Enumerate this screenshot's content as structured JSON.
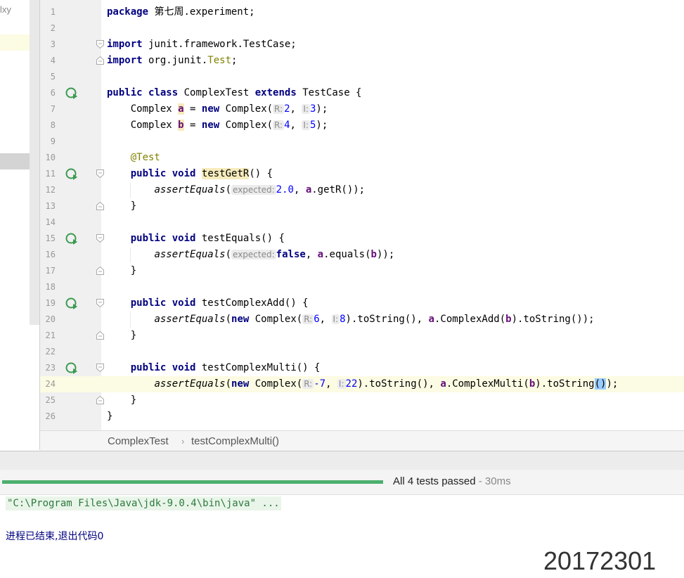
{
  "project_panel": {
    "label": "lxy"
  },
  "editor": {
    "lines": [
      {
        "num": "1"
      },
      {
        "num": "2"
      },
      {
        "num": "3"
      },
      {
        "num": "4"
      },
      {
        "num": "5"
      },
      {
        "num": "6"
      },
      {
        "num": "7"
      },
      {
        "num": "8"
      },
      {
        "num": "9"
      },
      {
        "num": "10"
      },
      {
        "num": "11"
      },
      {
        "num": "12"
      },
      {
        "num": "13"
      },
      {
        "num": "14"
      },
      {
        "num": "15"
      },
      {
        "num": "16"
      },
      {
        "num": "17"
      },
      {
        "num": "18"
      },
      {
        "num": "19"
      },
      {
        "num": "20"
      },
      {
        "num": "21"
      },
      {
        "num": "22"
      },
      {
        "num": "23"
      },
      {
        "num": "24"
      },
      {
        "num": "25"
      },
      {
        "num": "26"
      }
    ],
    "current_line": "24",
    "run_icon": "run-test-icon",
    "t": {
      "package_kw": "package",
      "package_name": " 第七周.experiment;",
      "import_kw": "import",
      "import1": " junit.framework.TestCase;",
      "import2_a": " org.junit.",
      "import2_test": "Test",
      "semi": ";",
      "public": "public",
      "class": "class",
      "class_name": " ComplexTest ",
      "extends": "extends",
      "parent": " TestCase {",
      "type_complex": "Complex ",
      "var_a": "a",
      "var_b": "b",
      "eq_new": " = ",
      "new": "new",
      "complex_ctor": " Complex(",
      "hint_r": "R:",
      "hint_i": "I:",
      "num_2": "2",
      "num_3": "3",
      "num_4": "4",
      "num_5": "5",
      "comma": ", ",
      "close_semi": ");",
      "at_test": "@Test",
      "void": "void",
      "testGetR": "testGetR",
      "sig_end": "() {",
      "assertEquals": "assertEquals",
      "open_paren": "(",
      "hint_expected": "expected:",
      "num_2_0": "2.0",
      "getR_call": ".getR());",
      "close_brace": "}",
      "testEquals": " testEquals() {",
      "false": "false",
      "equals_call": ".equals(",
      "close2": "));",
      "testComplexAdd": " testComplexAdd() {",
      "num_6": "6",
      "num_8": "8",
      "toString_comma": ").toString(), ",
      "complexAdd_call": ".ComplexAdd(",
      "toString_end": ").toString());",
      "testComplexMulti": " testComplexMulti() {",
      "num_m7": "-7",
      "num_22": "22",
      "complexMulti_call": ".ComplexMulti(",
      "toString_pre": ").toString",
      "paren_pair": "()",
      "end_semi": ");"
    }
  },
  "breadcrumb": {
    "items": [
      "ComplexTest",
      "testComplexMulti()"
    ],
    "separator": "›"
  },
  "run_panel": {
    "status": "All 4 tests passed",
    "time": " - 30ms",
    "progress": 1.0,
    "progress_color": "#4caf6e",
    "command": "\"C:\\Program Files\\Java\\jdk-9.0.4\\bin\\java\" ...",
    "exit_message": "进程已结束,退出代码0"
  },
  "overlay_text": "20172301"
}
